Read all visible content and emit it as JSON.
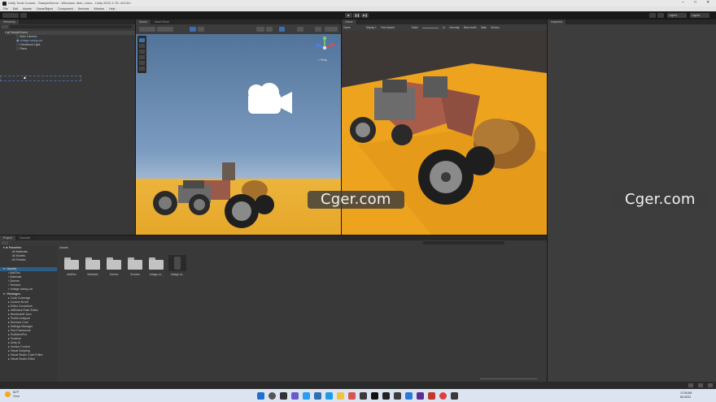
{
  "window": {
    "title": "Unity Tools Course - SampleScene - Windows, Mac, Linux - Unity 2022.1.7f1 <DX11>",
    "minimize": "–",
    "maximize": "□",
    "close": "✕"
  },
  "menu": [
    "File",
    "Edit",
    "Assets",
    "GameObject",
    "Component",
    "Services",
    "Window",
    "Help"
  ],
  "toolbar": {
    "account": "",
    "play": "▶",
    "pause": "❚❚",
    "step": "▶❚",
    "layers": "Layers",
    "layout": "Layout"
  },
  "hierarchy": {
    "tab": "Hierarchy",
    "items": [
      {
        "label": "SampleScene",
        "depth": 0
      },
      {
        "label": "Main Camera",
        "depth": 1
      },
      {
        "label": "vintage-racing-car",
        "depth": 1
      },
      {
        "label": "Directional Light",
        "depth": 1
      },
      {
        "label": "Plane",
        "depth": 1
      }
    ]
  },
  "scene": {
    "tabs": [
      "Scene",
      "Asset Store"
    ],
    "gizmo_label": "< Persp"
  },
  "game": {
    "tab": "Game",
    "toolbar": [
      "Game",
      "Display 1",
      "Free Aspect",
      "Scale",
      "1x",
      "Normally",
      "Mute Audio",
      "Stats",
      "Gizmos"
    ]
  },
  "inspector": {
    "tab": "Inspector"
  },
  "project": {
    "tabs": [
      "Project",
      "Console"
    ],
    "breadcrumb": "Assets",
    "favorites": {
      "label": "Favorites",
      "items": [
        "All Materials",
        "All Models",
        "All Prefabs"
      ]
    },
    "assets_tree": {
      "label": "Assets",
      "items": [
        "AddOns",
        "Materials",
        "Scenes",
        "Textures",
        "vintage-racing-car"
      ]
    },
    "packages": {
      "label": "Packages",
      "items": [
        "Code Coverage",
        "Custom NUnit",
        "Editor Coroutines",
        "JetBrains Rider Editor",
        "Newtonsoft Json",
        "Profile Analyzer",
        "Services Core",
        "Settings Manager",
        "Test Framework",
        "TextMeshPro",
        "Timeline",
        "Unity UI",
        "Version Control",
        "Visual Scripting",
        "Visual Studio Code Editor",
        "Visual Studio Editor"
      ]
    },
    "grid": [
      "AddOns",
      "Materials",
      "Scenes",
      "Textures",
      "vintage-ra...",
      "vintage-ra..."
    ]
  },
  "watermark": "Cger.com",
  "taskbar": {
    "weather_temp": "81°F",
    "weather_desc": "Clear",
    "time": "12:35 AM",
    "date": "8/1/2022"
  },
  "colors": {
    "sky_top": "#53749a",
    "ground": "#ecb43c",
    "game_ground": "#f0a020",
    "car_body": "#a0584a"
  }
}
